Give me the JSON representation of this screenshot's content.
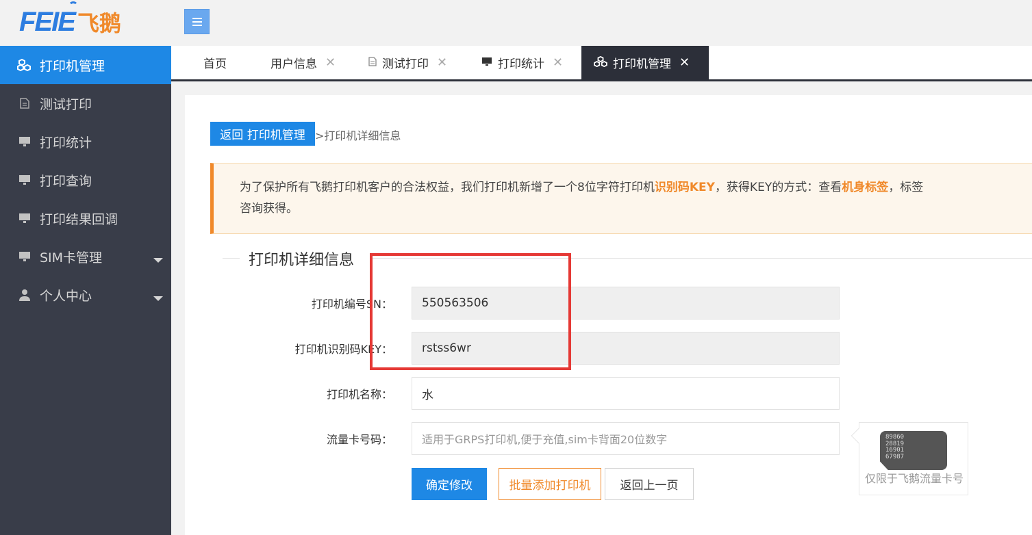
{
  "header": {
    "logo_text": "FEIE",
    "logo_cn": "飞鹅"
  },
  "sidebar": {
    "items": [
      {
        "label": "打印机管理",
        "icon": "cubes-icon",
        "active": true
      },
      {
        "label": "测试打印",
        "icon": "document-icon"
      },
      {
        "label": "打印统计",
        "icon": "monitor-icon"
      },
      {
        "label": "打印查询",
        "icon": "monitor-icon"
      },
      {
        "label": "打印结果回调",
        "icon": "monitor-icon"
      },
      {
        "label": "SIM卡管理",
        "icon": "monitor-icon",
        "has_caret": true
      },
      {
        "label": "个人中心",
        "icon": "user-icon",
        "has_caret": true
      }
    ]
  },
  "tabs": [
    {
      "label": "首页"
    },
    {
      "label": "用户信息",
      "closable": true
    },
    {
      "label": "测试打印",
      "icon": "document-icon",
      "closable": true
    },
    {
      "label": "打印统计",
      "icon": "monitor-icon",
      "closable": true
    },
    {
      "label": "打印机管理",
      "icon": "cubes-icon",
      "closable": true,
      "active": true
    }
  ],
  "breadcrumb": {
    "back_button": "返回 打印机管理",
    "current": ">打印机详细信息"
  },
  "notice": {
    "line1_a": "为了保护所有飞鹅打印机客户的合法权益，我们打印机新增了一个8位字符打印机",
    "line1_b": "识别码KEY",
    "line1_c": "，获得KEY的方式：查看",
    "line1_d": "机身标签",
    "line1_e": "，标签",
    "line2": "咨询获得。"
  },
  "form": {
    "legend": "打印机详细信息",
    "fields": [
      {
        "label": "打印机编号SN：",
        "value": "550563506",
        "readonly": true
      },
      {
        "label": "打印机识别码KEY：",
        "value": "rstss6wr",
        "readonly": true
      },
      {
        "label": "打印机名称：",
        "value": "水"
      },
      {
        "label": "流量卡号码：",
        "value": "",
        "placeholder": "适用于GRPS打印机,便于充值,sim卡背面20位数字"
      }
    ],
    "buttons": {
      "confirm": "确定修改",
      "batch_add": "批量添加打印机",
      "back": "返回上一页"
    }
  },
  "sim_tip": {
    "card_lines": [
      "89860",
      "28819",
      "16901",
      "67987"
    ],
    "caption": "仅限于飞鹅流量卡号"
  },
  "colors": {
    "primary": "#1e88e5",
    "accent": "#f0892a",
    "sidebar_bg": "#393d49",
    "highlight_box": "#e53935"
  }
}
